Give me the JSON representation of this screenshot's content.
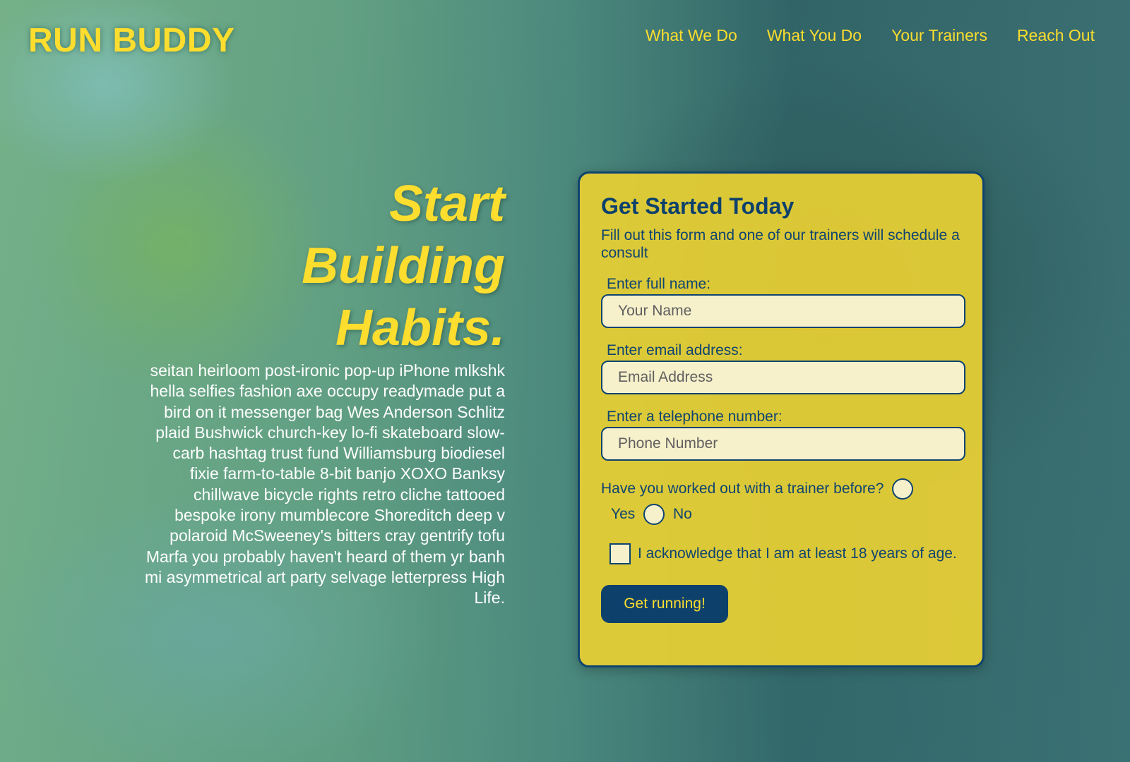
{
  "header": {
    "logo": "RUN BUDDY",
    "nav": [
      "What We Do",
      "What You Do",
      "Your Trainers",
      "Reach Out"
    ]
  },
  "hero": {
    "title_lines": [
      "Start",
      "Building",
      "Habits."
    ],
    "body": "seitan heirloom post-ironic pop-up iPhone mlkshk hella selfies fashion axe occupy readymade put a bird on it messenger bag Wes Anderson Schlitz plaid Bushwick church-key lo-fi skateboard slow-carb hashtag trust fund Williamsburg biodiesel fixie farm-to-table 8-bit banjo XOXO Banksy chillwave bicycle rights retro cliche tattooed bespoke irony mumblecore Shoreditch deep v polaroid McSweeney's bitters cray gentrify tofu Marfa you probably haven't heard of them yr banh mi asymmetrical art party selvage letterpress High Life."
  },
  "form": {
    "title": "Get Started Today",
    "subtitle": "Fill out this form and one of our trainers will schedule a consult",
    "name_label": "Enter full name:",
    "name_placeholder": "Your Name",
    "email_label": "Enter email address:",
    "email_placeholder": "Email Address",
    "phone_label": "Enter a telephone number:",
    "phone_placeholder": "Phone Number",
    "trainer_question": "Have you worked out with a trainer before?",
    "yes_label": "Yes",
    "no_label": "No",
    "age_ack": "I acknowledge that I am at least 18 years of age.",
    "submit_label": "Get running!"
  },
  "colors": {
    "accent_yellow": "#fddd2e",
    "navy": "#0d416c"
  }
}
